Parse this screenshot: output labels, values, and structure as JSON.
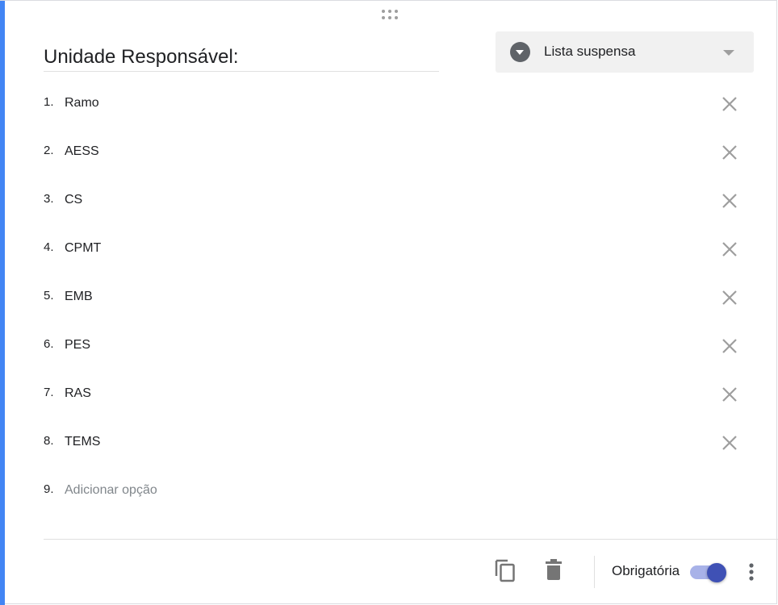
{
  "question": {
    "title": "Unidade Responsável:",
    "type_label": "Lista suspensa",
    "type_icon": "dropdown-circle-icon"
  },
  "options": [
    {
      "number": "1.",
      "label": "Ramo"
    },
    {
      "number": "2.",
      "label": "AESS"
    },
    {
      "number": "3.",
      "label": "CS"
    },
    {
      "number": "4.",
      "label": "CPMT"
    },
    {
      "number": "5.",
      "label": "EMB"
    },
    {
      "number": "6.",
      "label": "PES"
    },
    {
      "number": "7.",
      "label": "RAS"
    },
    {
      "number": "8.",
      "label": "TEMS"
    }
  ],
  "add_option": {
    "number": "9.",
    "placeholder": "Adicionar opção"
  },
  "footer": {
    "required_label": "Obrigatória",
    "required_on": true,
    "icons": [
      "duplicate-icon",
      "delete-icon",
      "more-vert-icon"
    ]
  },
  "colors": {
    "accent": "#4285f4",
    "toggle": "#3f51b5"
  }
}
